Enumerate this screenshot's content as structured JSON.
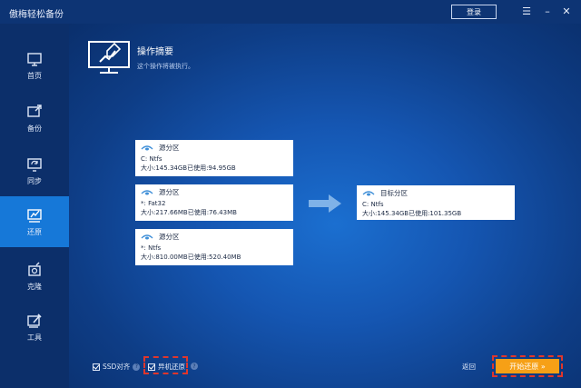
{
  "titlebar": {
    "app_title": "傲梅轻松备份",
    "login_label": "登录",
    "menu_glyph": "☰",
    "minimize_glyph": "–",
    "close_glyph": "✕"
  },
  "sidebar": {
    "items": [
      {
        "label": "首页",
        "icon": "home-monitor-icon",
        "active": false
      },
      {
        "label": "备份",
        "icon": "backup-icon",
        "active": false
      },
      {
        "label": "同步",
        "icon": "sync-icon",
        "active": false
      },
      {
        "label": "还原",
        "icon": "restore-icon",
        "active": true
      },
      {
        "label": "克隆",
        "icon": "clone-icon",
        "active": false
      },
      {
        "label": "工具",
        "icon": "tools-icon",
        "active": false
      }
    ]
  },
  "header": {
    "title": "操作摘要",
    "subtitle": "这个操作将被执行。"
  },
  "source_partitions": [
    {
      "title": "源分区",
      "line1": "C: Ntfs",
      "line2": "大小:145.34GB已使用:94.95GB"
    },
    {
      "title": "源分区",
      "line1": "*: Fat32",
      "line2": "大小:217.66MB已使用:76.43MB"
    },
    {
      "title": "源分区",
      "line1": "*: Ntfs",
      "line2": "大小:810.00MB已使用:520.40MB"
    }
  ],
  "target_partition": {
    "title": "目标分区",
    "line1": "C: Ntfs",
    "line2": "大小:145.34GB已使用:101.35GB"
  },
  "footer": {
    "ssd_align_label": "SSD对齐",
    "universal_restore_label": "异机还原",
    "help_glyph": "?",
    "back_label": "返回",
    "start_label": "开始还原 »"
  },
  "colors": {
    "accent": "#1678d8",
    "start_button": "#f6a016",
    "highlight_border": "#e0362b"
  }
}
